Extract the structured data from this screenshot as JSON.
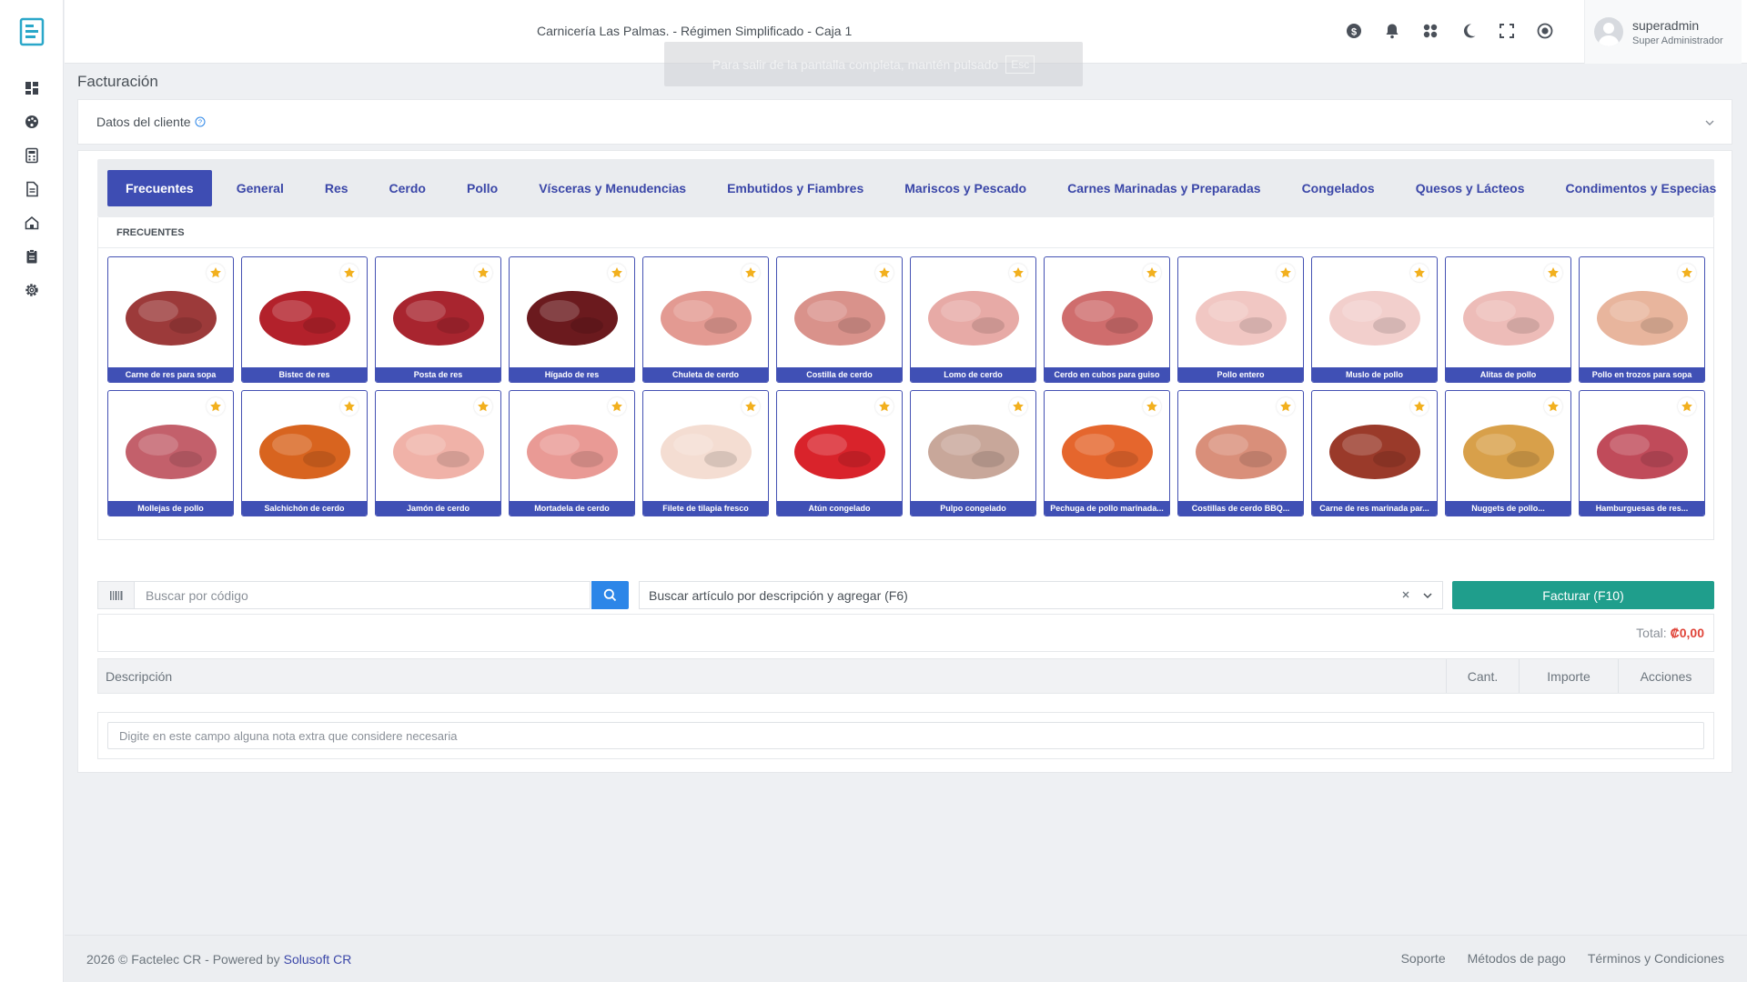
{
  "header": {
    "title": "Carnicería Las Palmas. - Régimen Simplificado - Caja 1",
    "fullscreen_toast": "Para salir de la pantalla completa, mantén pulsado",
    "fullscreen_key": "Esc",
    "user_name": "superadmin",
    "user_role": "Super Administrador"
  },
  "page": {
    "title": "Facturación",
    "client_section": "Datos del cliente"
  },
  "categories": [
    "Frecuentes",
    "General",
    "Res",
    "Cerdo",
    "Pollo",
    "Vísceras y Menudencias",
    "Embutidos y Fiambres",
    "Mariscos y Pescado",
    "Carnes Marinadas y Preparadas",
    "Congelados",
    "Quesos y Lácteos",
    "Condimentos y Especias"
  ],
  "section_heading": "FRECUENTES",
  "products": [
    {
      "name": "Carne de res para sopa",
      "color": "#9c3a3a"
    },
    {
      "name": "Bistec de res",
      "color": "#b3212b"
    },
    {
      "name": "Posta de res",
      "color": "#a8252f"
    },
    {
      "name": "Hígado de res",
      "color": "#6b1a1e"
    },
    {
      "name": "Chuleta de cerdo",
      "color": "#e39a92"
    },
    {
      "name": "Costilla de cerdo",
      "color": "#d9928b"
    },
    {
      "name": "Lomo de cerdo",
      "color": "#e7aaa6"
    },
    {
      "name": "Cerdo en cubos para guiso",
      "color": "#cf6d6d"
    },
    {
      "name": "Pollo entero",
      "color": "#f1c7c3"
    },
    {
      "name": "Muslo de pollo",
      "color": "#f2cfcc"
    },
    {
      "name": "Alitas de pollo",
      "color": "#edbcb8"
    },
    {
      "name": "Pollo en trozos para sopa",
      "color": "#e8b59d"
    },
    {
      "name": "Mollejas de pollo",
      "color": "#c3606b"
    },
    {
      "name": "Salchichón de cerdo",
      "color": "#d8641f"
    },
    {
      "name": "Jamón de cerdo",
      "color": "#f0b2a8"
    },
    {
      "name": "Mortadela de cerdo",
      "color": "#e99a95"
    },
    {
      "name": "Filete de tilapia fresco",
      "color": "#f4ddd2"
    },
    {
      "name": "Atún congelado",
      "color": "#d9232b"
    },
    {
      "name": "Pulpo congelado",
      "color": "#c8a79a"
    },
    {
      "name": "Pechuga de pollo marinada...",
      "color": "#e5662d"
    },
    {
      "name": "Costillas de cerdo BBQ...",
      "color": "#d98f7a"
    },
    {
      "name": "Carne de res marinada par...",
      "color": "#9a3a2a"
    },
    {
      "name": "Nuggets de pollo...",
      "color": "#d8a04a"
    },
    {
      "name": "Hamburguesas de res...",
      "color": "#c04b5a"
    }
  ],
  "search": {
    "code_placeholder": "Buscar por código",
    "description_value": "Buscar artículo por descripción y agregar (F6)",
    "invoice_button": "Facturar (F10)"
  },
  "totals": {
    "label": "Total:",
    "value": "₡0,00"
  },
  "table": {
    "col_description": "Descripción",
    "col_qty": "Cant.",
    "col_amount": "Importe",
    "col_actions": "Acciones"
  },
  "note": {
    "placeholder": "Digite en este campo alguna nota extra que considere necesaria"
  },
  "footer": {
    "copyright": "2026 © Factelec CR - Powered by",
    "powered_link": "Solusoft CR",
    "links": [
      "Soporte",
      "Métodos de pago",
      "Términos y Condiciones"
    ]
  },
  "colors": {
    "primary": "#3e4db3",
    "invoice": "#1f9e8c",
    "search": "#2c86e8",
    "total": "#e0453a",
    "star": "#f2b01e"
  }
}
